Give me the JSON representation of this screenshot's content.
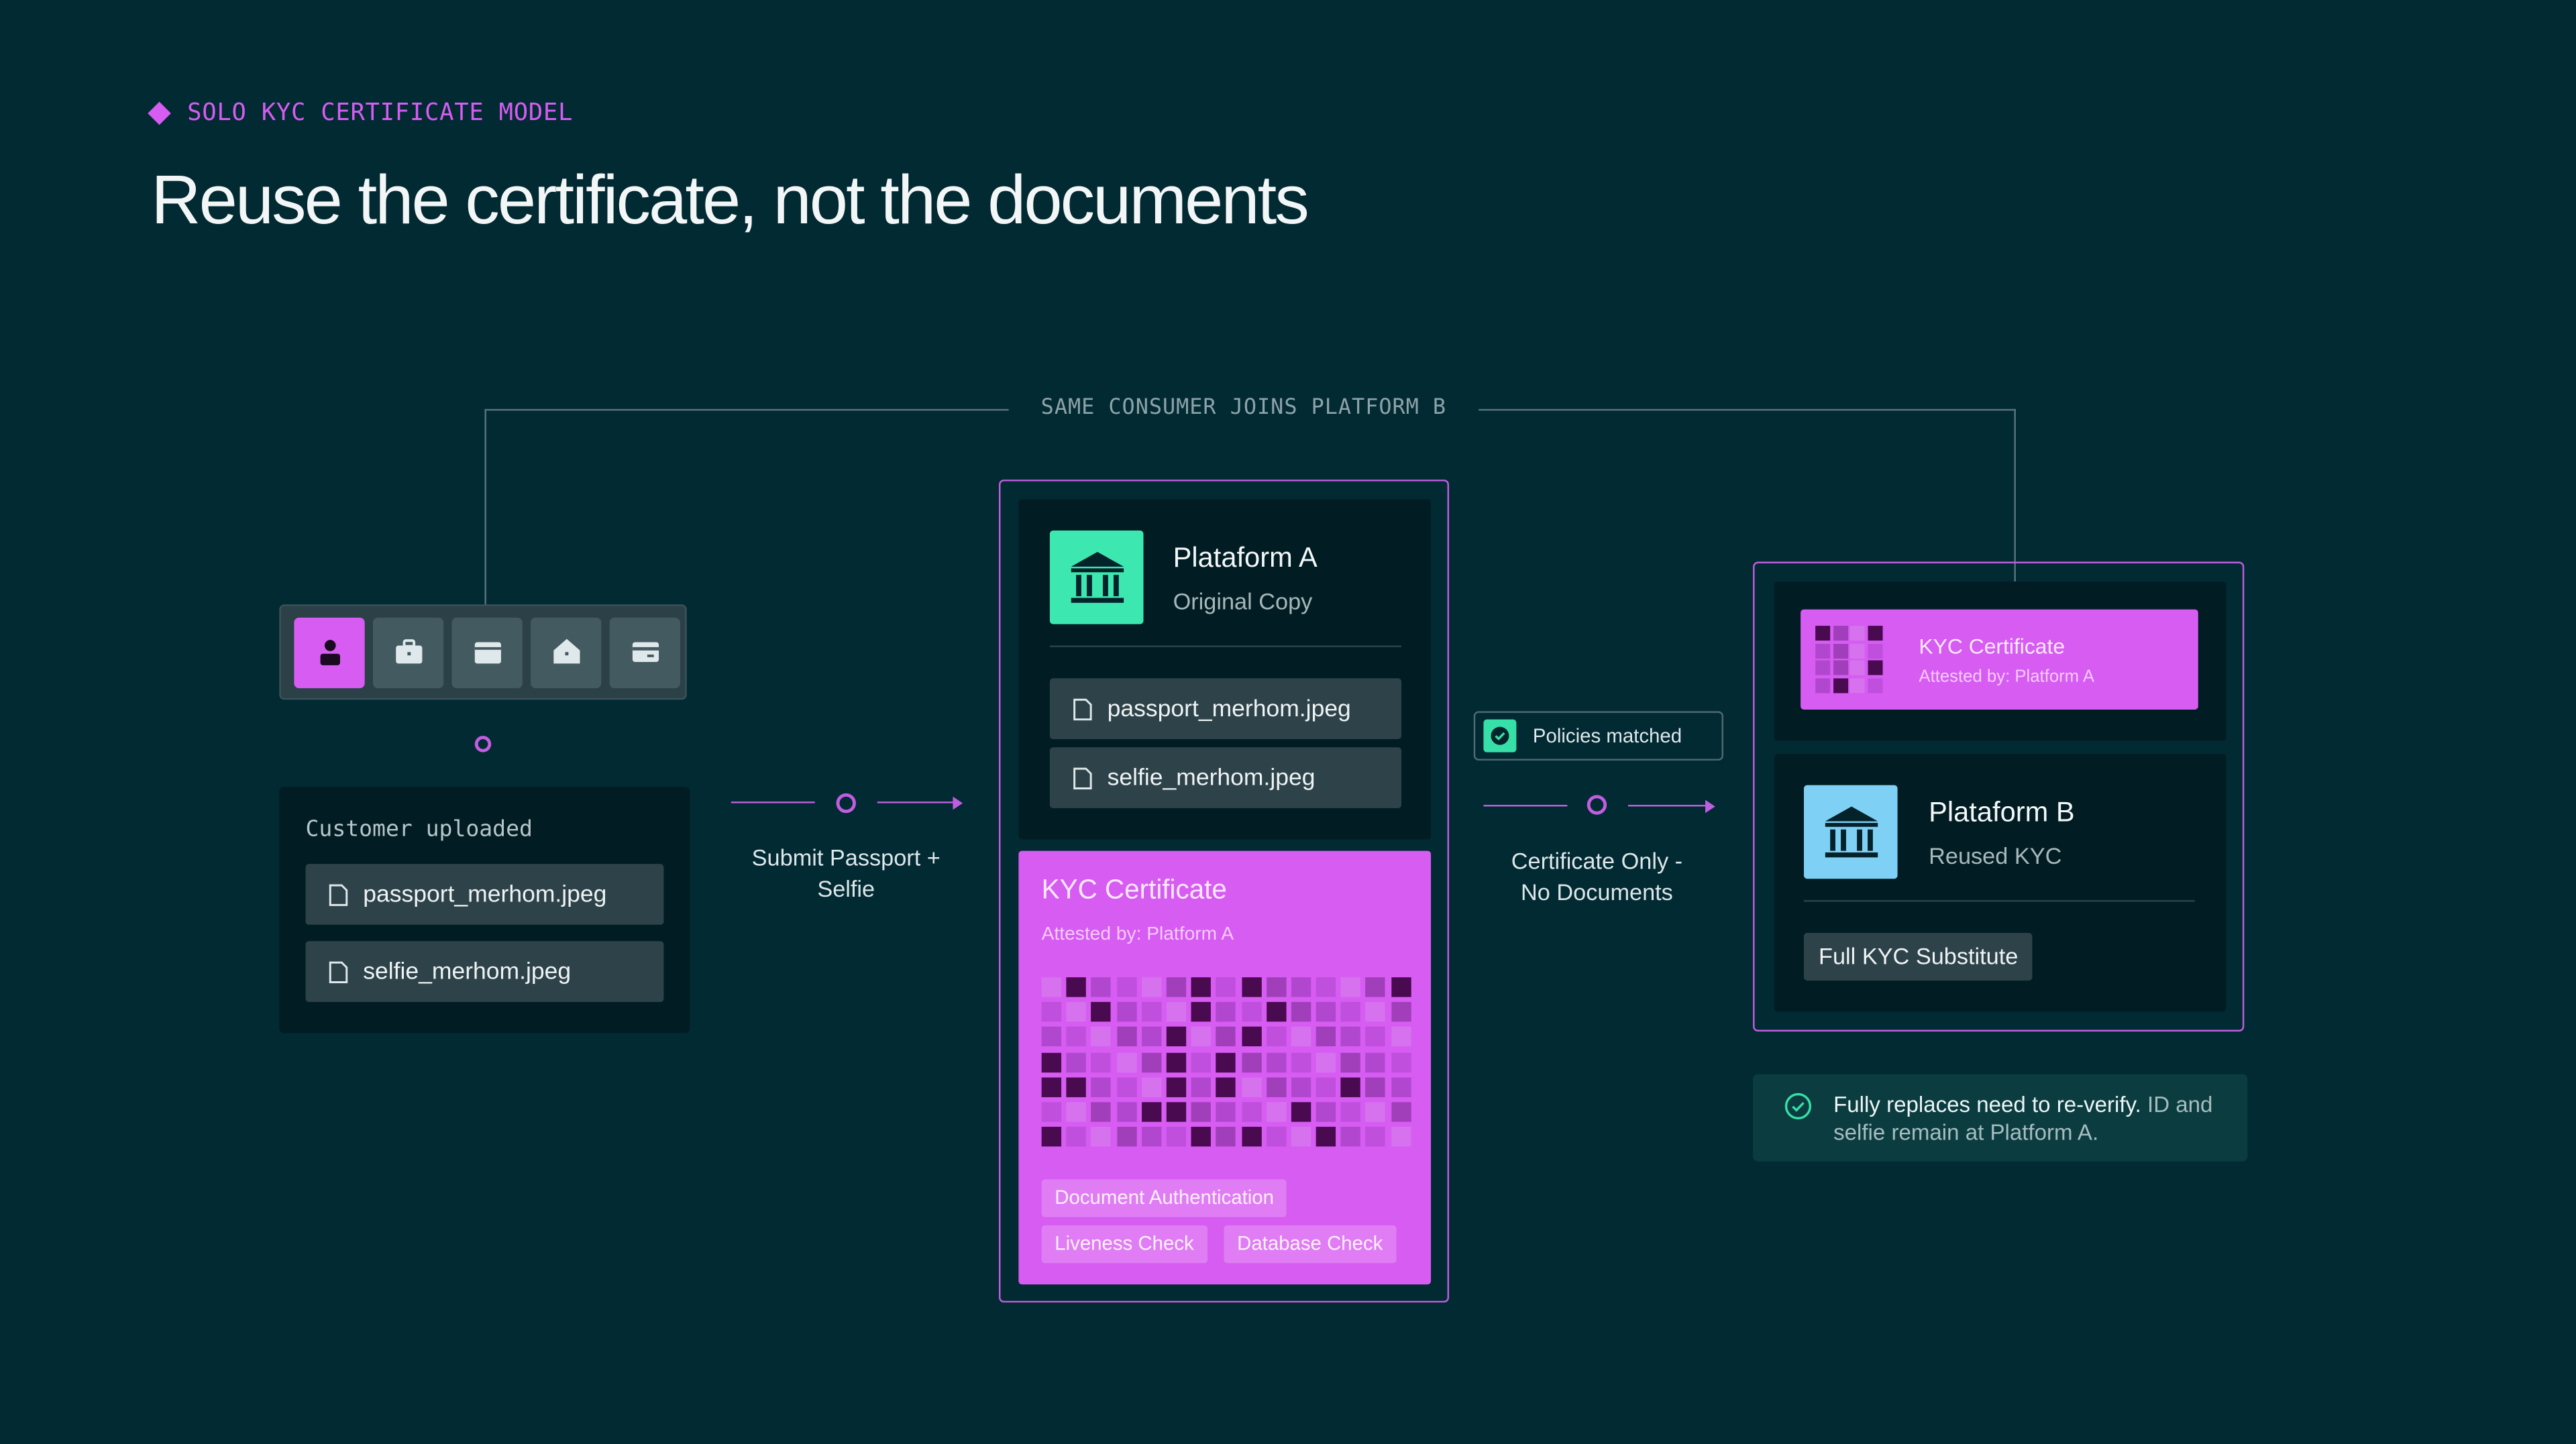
{
  "header": {
    "eyebrow": "SOLO KYC CERTIFICATE MODEL",
    "title": "Reuse the certificate, not the documents"
  },
  "bracket_label": "SAME CONSUMER JOINS PLATFORM B",
  "toolbar": {
    "icons": [
      "person-icon",
      "briefcase-icon",
      "wallet-icon",
      "home-icon",
      "credit-card-icon"
    ],
    "active_index": 0
  },
  "upload": {
    "title": "Customer uploaded",
    "files": [
      "passport_merhom.jpeg",
      "selfie_merhom.jpeg"
    ]
  },
  "step1_caption": [
    "Submit Passport +",
    "Selfie"
  ],
  "platform_a": {
    "name": "Plataform A",
    "subtitle": "Original Copy",
    "files": [
      "passport_merhom.jpeg",
      "selfie_merhom.jpeg"
    ]
  },
  "kyc_certificate": {
    "title": "KYC Certificate",
    "attested": "Attested by: Platform A",
    "checks": [
      "Document Authentication",
      "Liveness Check",
      "Database Check"
    ]
  },
  "policies": "Policies matched",
  "step2_caption": [
    "Certificate Only -",
    "No Documents"
  ],
  "platform_b": {
    "cert_title": "KYC Certificate",
    "cert_attested": "Attested by: Platform A",
    "name": "Plataform B",
    "subtitle": "Reused KYC",
    "badge": "Full KYC Substitute"
  },
  "note": {
    "strong": "Fully replaces need to re-verify.",
    "rest": " ID and selfie remain at Platform A."
  },
  "colors": {
    "background": "#022a33",
    "accent": "#d65cf2",
    "platform_a_bank": "#3de8b0",
    "platform_b_bank": "#7fd0f5",
    "check": "#36e0a8"
  }
}
